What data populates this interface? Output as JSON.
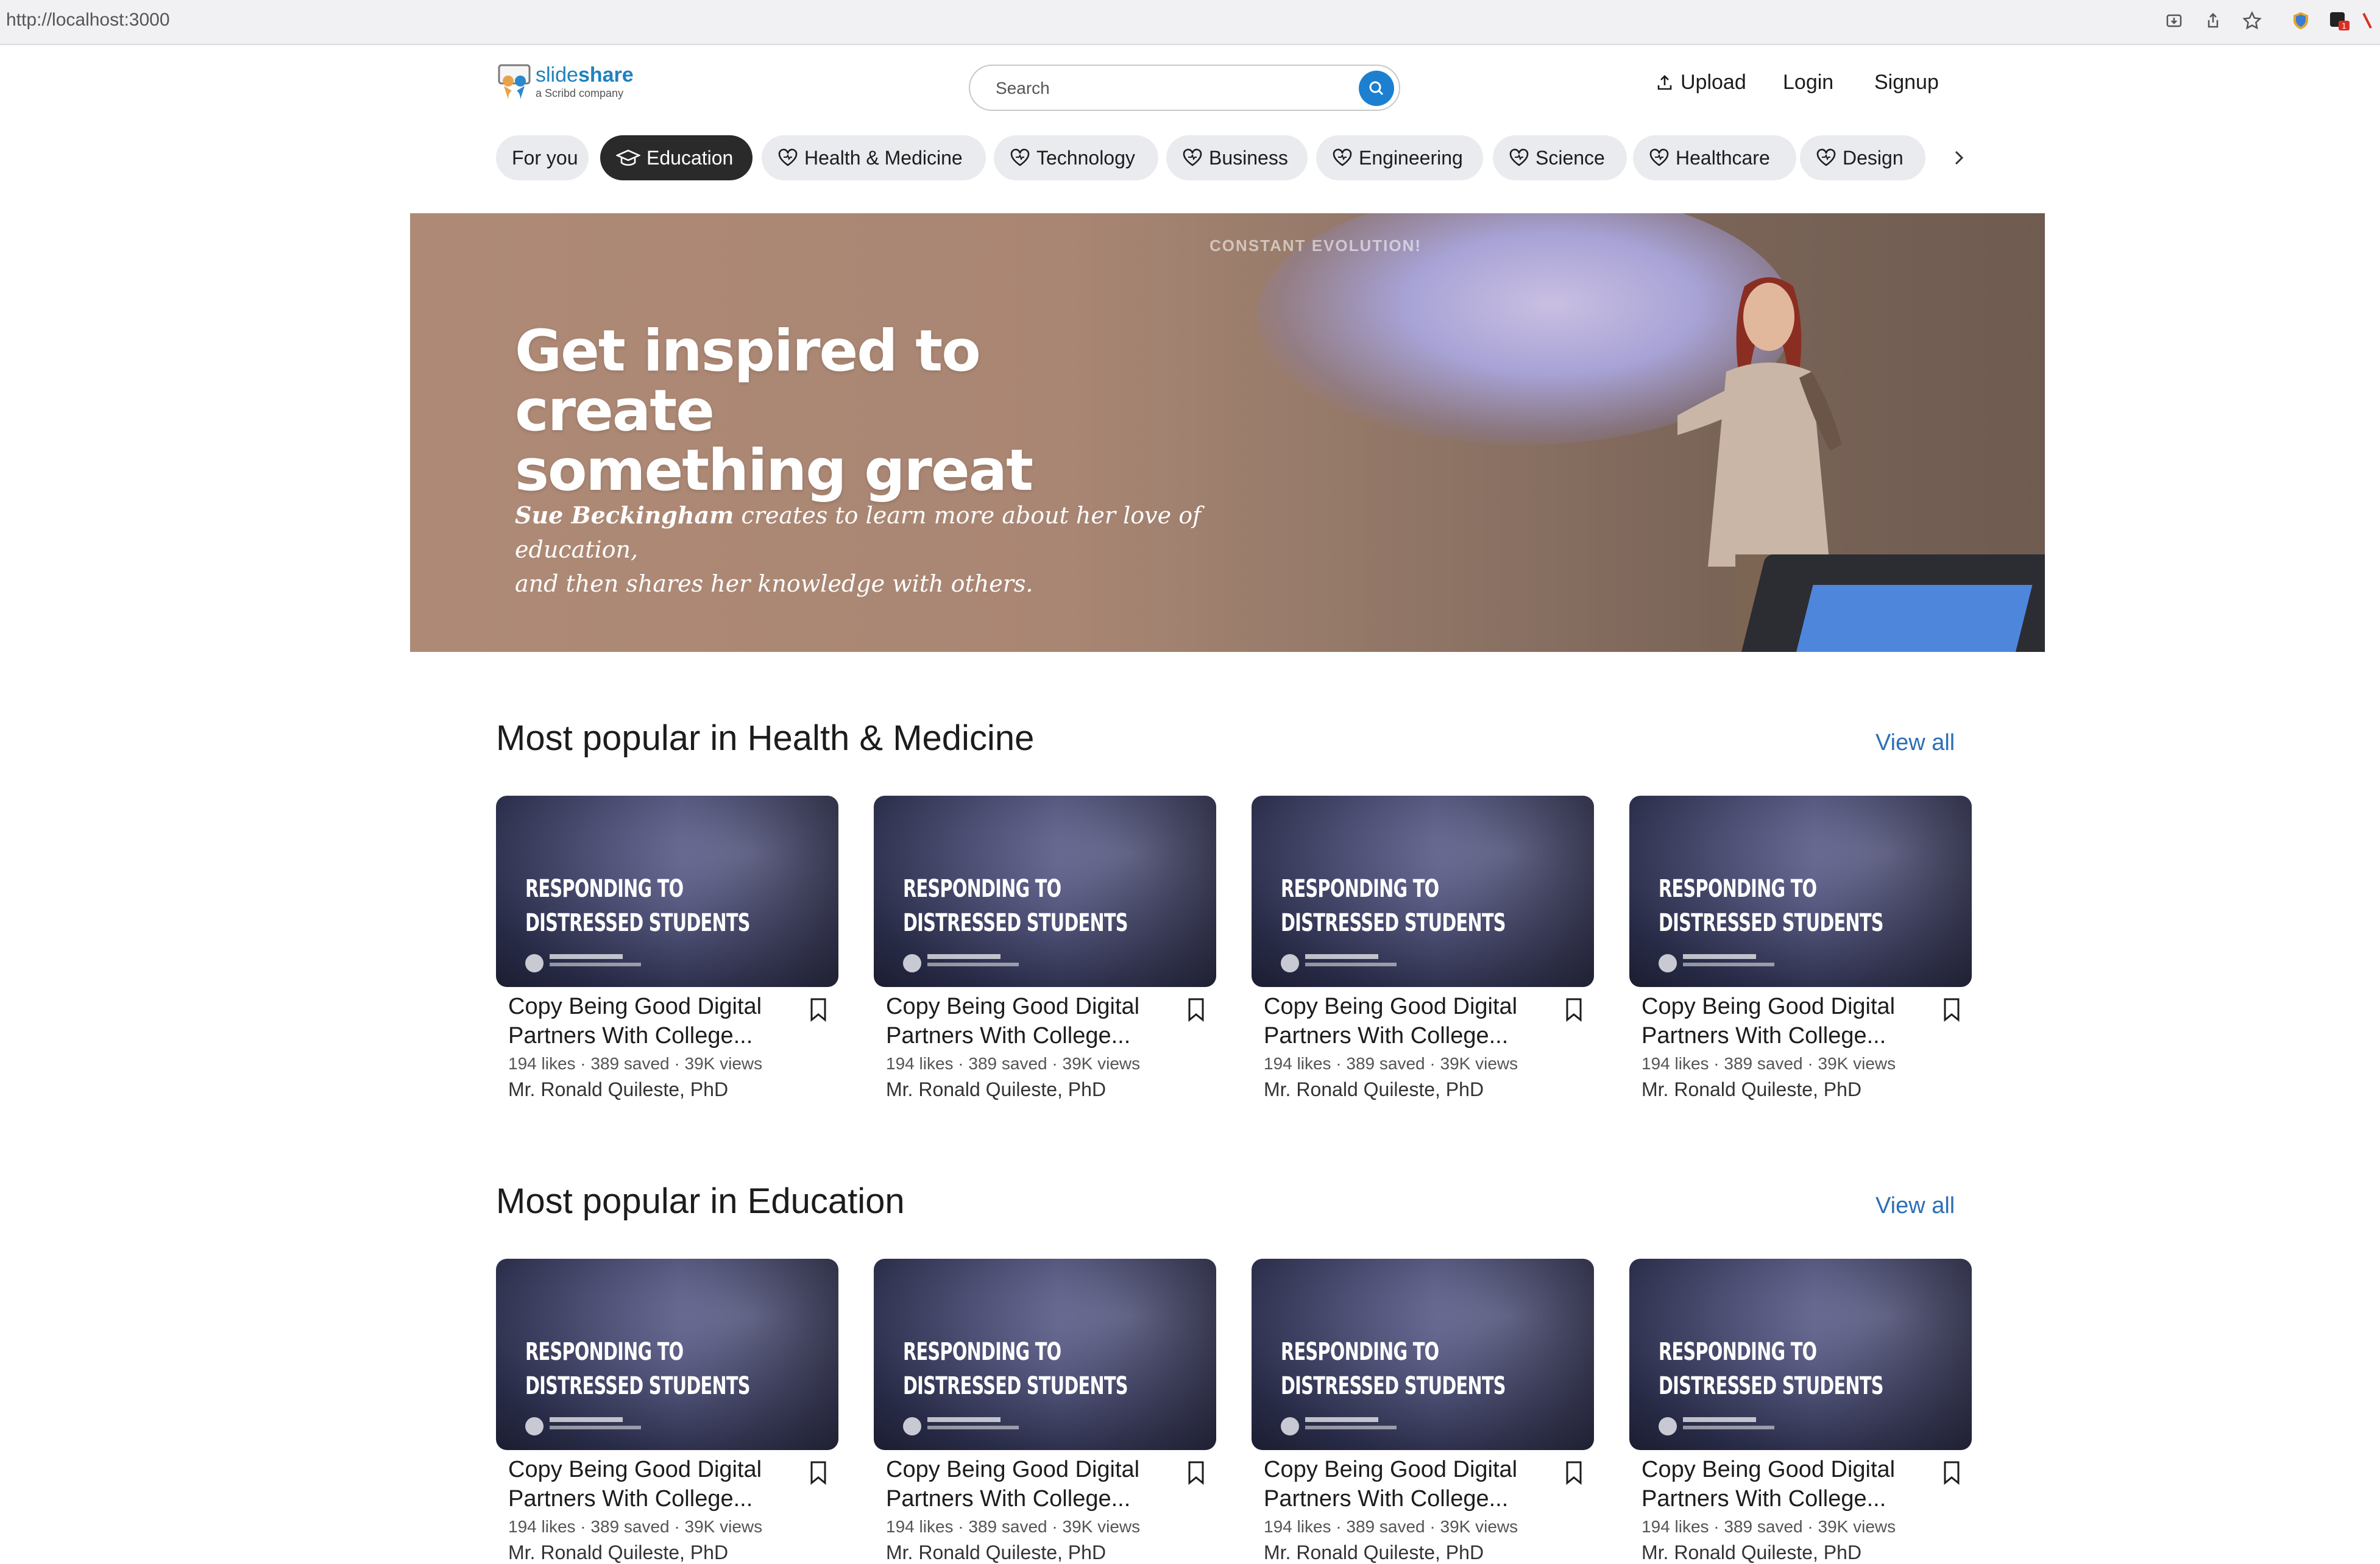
{
  "browser": {
    "url": "http://localhost:3000"
  },
  "header": {
    "logo_name_light": "slide",
    "logo_name_bold": "share",
    "logo_sub": "a Scribd company",
    "search_placeholder": "Search",
    "upload": "Upload",
    "login": "Login",
    "signup": "Signup"
  },
  "categories": [
    {
      "label": "For you",
      "icon": "none",
      "active": false
    },
    {
      "label": "Education",
      "icon": "graduation-cap-icon",
      "active": true
    },
    {
      "label": "Health & Medicine",
      "icon": "heart-icon",
      "active": false
    },
    {
      "label": "Technology",
      "icon": "heart-icon",
      "active": false
    },
    {
      "label": "Business",
      "icon": "heart-icon",
      "active": false
    },
    {
      "label": "Engineering",
      "icon": "heart-icon",
      "active": false
    },
    {
      "label": "Science",
      "icon": "heart-icon",
      "active": false
    },
    {
      "label": "Healthcare",
      "icon": "heart-icon",
      "active": false
    },
    {
      "label": "Design",
      "icon": "heart-icon",
      "active": false
    }
  ],
  "hero": {
    "screen_text": "CONSTANT EVOLUTION!",
    "title_line1": "Get inspired to create",
    "title_line2": "something great",
    "author": "Sue Beckingham",
    "desc_line1": " creates to learn more about her love of education,",
    "desc_line2": "and then shares her knowledge with others."
  },
  "sections": [
    {
      "title": "Most popular in Health & Medicine",
      "view_all": "View all",
      "cards": [
        {
          "thumb_l1": "RESPONDING TO",
          "thumb_l2": "DISTRESSED STUDENTS",
          "title": "Copy Being Good Digital Partners With College...",
          "likes": "194 likes",
          "saved": "389 saved",
          "views": "39K views",
          "author": "Mr. Ronald Quileste, PhD"
        },
        {
          "thumb_l1": "RESPONDING TO",
          "thumb_l2": "DISTRESSED STUDENTS",
          "title": "Copy Being Good Digital Partners With College...",
          "likes": "194 likes",
          "saved": "389 saved",
          "views": "39K views",
          "author": "Mr. Ronald Quileste, PhD"
        },
        {
          "thumb_l1": "RESPONDING TO",
          "thumb_l2": "DISTRESSED STUDENTS",
          "title": "Copy Being Good Digital Partners With College...",
          "likes": "194 likes",
          "saved": "389 saved",
          "views": "39K views",
          "author": "Mr. Ronald Quileste, PhD"
        },
        {
          "thumb_l1": "RESPONDING TO",
          "thumb_l2": "DISTRESSED STUDENTS",
          "title": "Copy Being Good Digital Partners With College...",
          "likes": "194 likes",
          "saved": "389 saved",
          "views": "39K views",
          "author": "Mr. Ronald Quileste, PhD"
        }
      ]
    },
    {
      "title": "Most popular in Education",
      "view_all": "View all",
      "cards": [
        {
          "thumb_l1": "RESPONDING TO",
          "thumb_l2": "DISTRESSED STUDENTS",
          "title": "Copy Being Good Digital Partners With College...",
          "likes": "194 likes",
          "saved": "389 saved",
          "views": "39K views",
          "author": "Mr. Ronald Quileste, PhD"
        },
        {
          "thumb_l1": "RESPONDING TO",
          "thumb_l2": "DISTRESSED STUDENTS",
          "title": "Copy Being Good Digital Partners With College...",
          "likes": "194 likes",
          "saved": "389 saved",
          "views": "39K views",
          "author": "Mr. Ronald Quileste, PhD"
        },
        {
          "thumb_l1": "RESPONDING TO",
          "thumb_l2": "DISTRESSED STUDENTS",
          "title": "Copy Being Good Digital Partners With College...",
          "likes": "194 likes",
          "saved": "389 saved",
          "views": "39K views",
          "author": "Mr. Ronald Quileste, PhD"
        },
        {
          "thumb_l1": "RESPONDING TO",
          "thumb_l2": "DISTRESSED STUDENTS",
          "title": "Copy Being Good Digital Partners With College...",
          "likes": "194 likes",
          "saved": "389 saved",
          "views": "39K views",
          "author": "Mr. Ronald Quileste, PhD"
        }
      ]
    }
  ],
  "colors": {
    "accent": "#1d7fd0",
    "link": "#2d6fb7",
    "pill_active": "#2a2a2a",
    "pill": "#e9ebee"
  }
}
